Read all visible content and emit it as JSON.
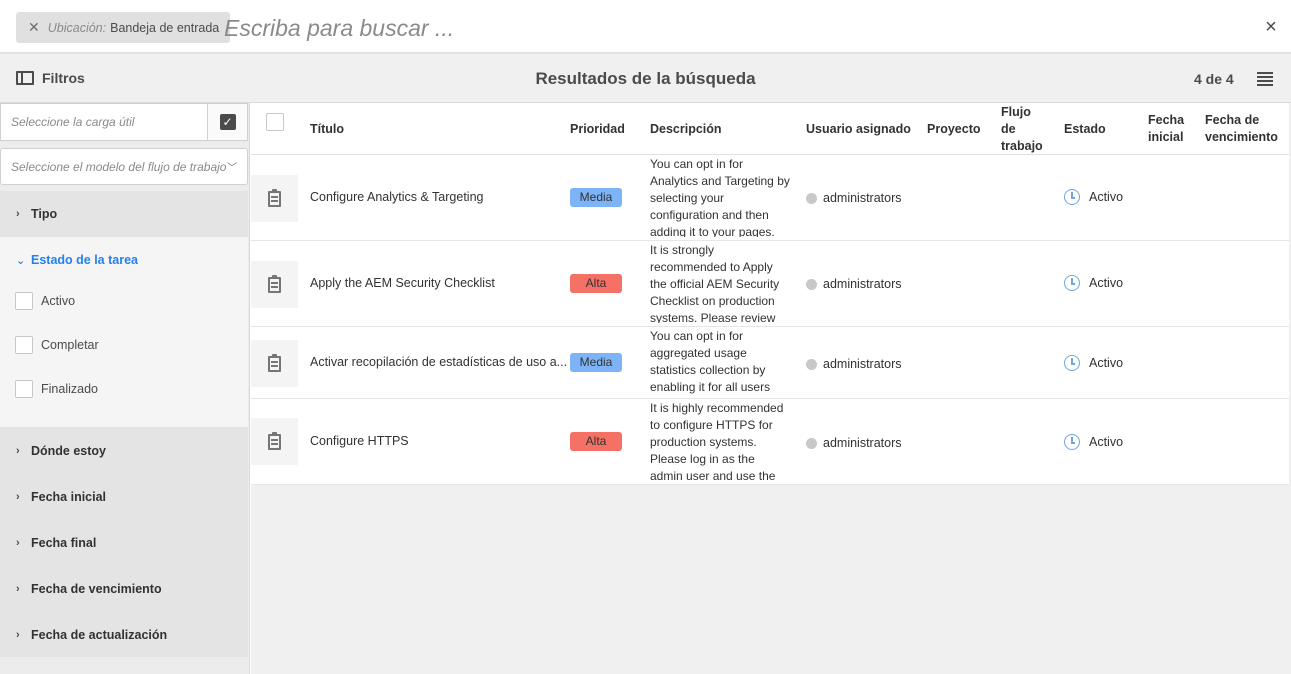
{
  "search": {
    "location_key": "Ubicación:",
    "location_value": "Bandeja de entrada",
    "placeholder": "Escriba para buscar ...",
    "value": ""
  },
  "toolbar": {
    "filters_label": "Filtros",
    "title": "Resultados de la búsqueda",
    "count": "4 de 4"
  },
  "filters": {
    "payload_placeholder": "Seleccione la carga útil",
    "workflow_model_placeholder": "Seleccione el modelo del flujo de trabajo",
    "sections": {
      "tipo": "Tipo",
      "estado": "Estado de la tarea",
      "donde": "Dónde estoy",
      "fecha_inicial": "Fecha inicial",
      "fecha_final": "Fecha final",
      "fecha_vencimiento": "Fecha de vencimiento",
      "fecha_actualizacion": "Fecha de actualización"
    },
    "estado_options": [
      "Activo",
      "Completar",
      "Finalizado"
    ]
  },
  "table": {
    "headers": {
      "titulo": "Título",
      "prioridad": "Prioridad",
      "descripcion": "Descripción",
      "usuario": "Usuario asignado",
      "proyecto": "Proyecto",
      "flujo": [
        "Flujo",
        "de",
        "trabajo"
      ],
      "estado": "Estado",
      "fecha_inicial": [
        "Fecha",
        "inicial"
      ],
      "fecha_vencimiento": [
        "Fecha de",
        "vencimiento"
      ]
    },
    "rows": [
      {
        "title": "Configure Analytics & Targeting",
        "priority": "Media",
        "description": "You can opt in for Analytics and Targeting by selecting your configuration and then adding it to your pages.",
        "assignee": "administrators",
        "status": "Activo"
      },
      {
        "title": "Apply the AEM Security Checklist",
        "priority": "Alta",
        "description": "It is strongly recommended to Apply the official AEM Security Checklist on production systems. Please review",
        "assignee": "administrators",
        "status": "Activo"
      },
      {
        "title": "Activar recopilación de estadísticas de uso a...",
        "priority": "Media",
        "description": "You can opt in for aggregated usage statistics collection by enabling it for all users",
        "assignee": "administrators",
        "status": "Activo"
      },
      {
        "title": "Configure HTTPS",
        "priority": "Alta",
        "description": "It is highly recommended to configure HTTPS for production systems. Please log in as the admin user and use the SSL",
        "assignee": "administrators",
        "status": "Activo"
      }
    ]
  },
  "colors": {
    "priority_media": "#7cb4f7",
    "priority_alta": "#f57166",
    "accent": "#2680eb"
  }
}
